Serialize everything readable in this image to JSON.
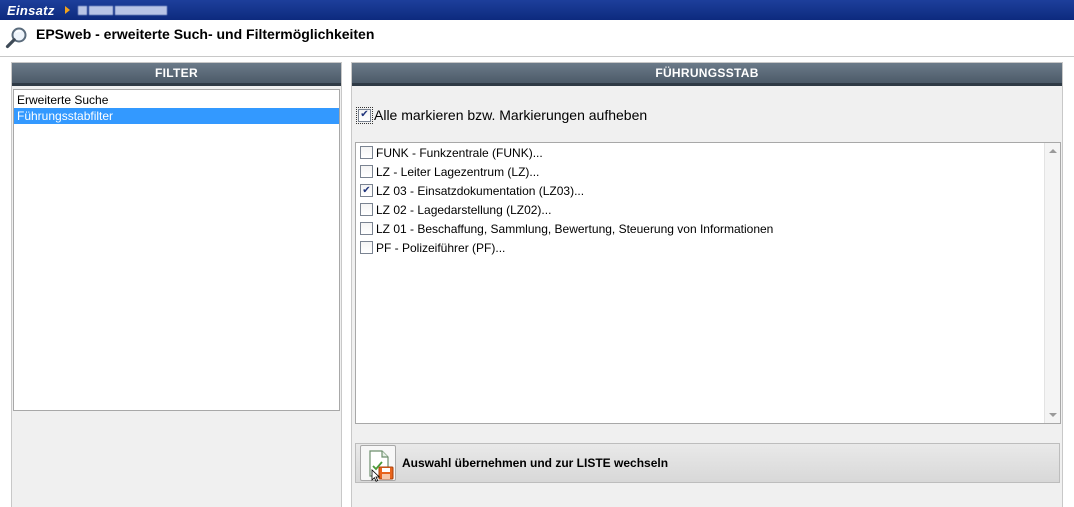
{
  "topbar": {
    "app_name": "Einsatz"
  },
  "header": {
    "title": "EPSweb - erweiterte Such- und Filtermöglichkeiten"
  },
  "filter_panel": {
    "heading": "FILTER",
    "items": [
      {
        "label": "Erweiterte Suche",
        "selected": false
      },
      {
        "label": "Führungsstabfilter",
        "selected": true
      }
    ]
  },
  "stab_panel": {
    "heading": "FÜHRUNGSSTAB",
    "select_all_label": "Alle markieren bzw. Markierungen aufheben",
    "select_all_checked": true,
    "items": [
      {
        "label": "FUNK - Funkzentrale (FUNK)...",
        "checked": false
      },
      {
        "label": "LZ - Leiter Lagezentrum (LZ)...",
        "checked": false
      },
      {
        "label": "LZ 03 - Einsatzdokumentation (LZ03)...",
        "checked": true
      },
      {
        "label": "LZ 02 - Lagedarstellung (LZ02)...",
        "checked": false
      },
      {
        "label": "LZ 01 - Beschaffung, Sammlung, Bewertung, Steuerung von Informationen",
        "checked": false
      },
      {
        "label": "PF - Polizeiführer (PF)...",
        "checked": false
      }
    ],
    "action_label": "Auswahl übernehmen und zur LISTE wechseln"
  },
  "colors": {
    "topbar": "#0d2a7e",
    "selection": "#3399ff",
    "panel_header": "#4c5a68",
    "accent_orange": "#f2a21b"
  },
  "icons": {
    "title": "magnifier-icon",
    "action": "document-save-icon"
  }
}
